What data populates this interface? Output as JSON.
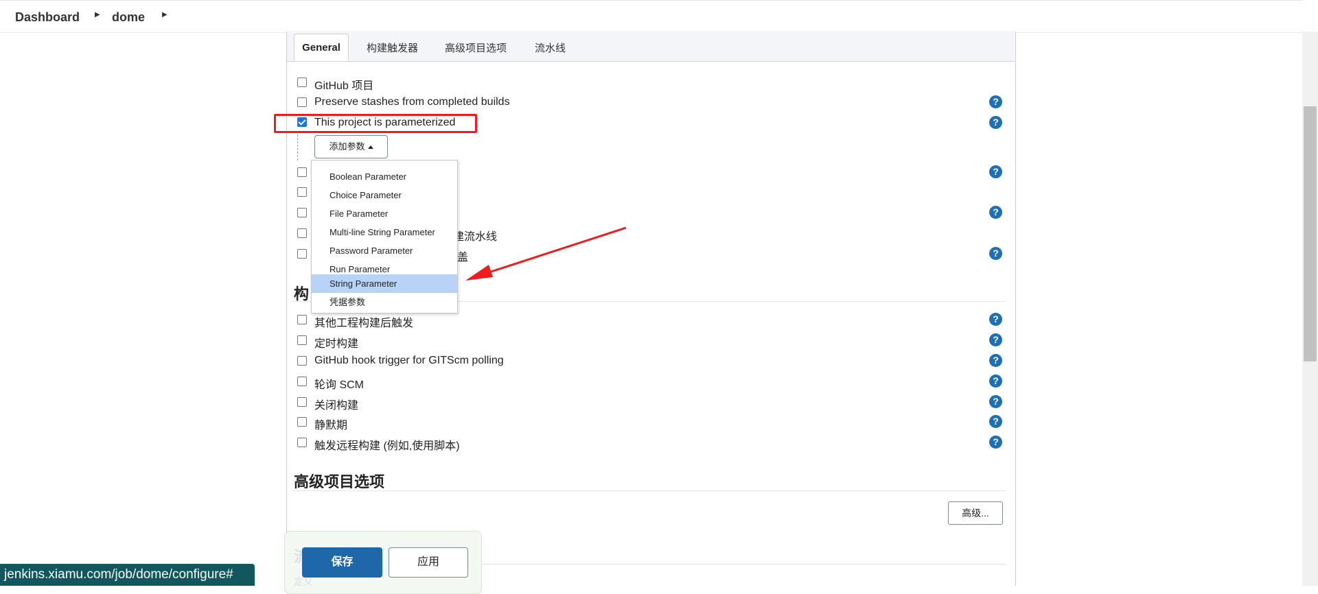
{
  "breadcrumb": [
    "Dashboard",
    "dome"
  ],
  "tabs": [
    "General",
    "构建触发器",
    "高级项目选项",
    "流水线"
  ],
  "general_options": [
    {
      "label": "GitHub 项目",
      "checked": false,
      "help": false
    },
    {
      "label": "Preserve stashes from completed builds",
      "checked": false,
      "help": true
    },
    {
      "label": "This project is parameterized",
      "checked": true,
      "help": true
    }
  ],
  "add_param_button": "添加参数",
  "hidden_row_fragments": [
    "建流水线",
    "盖"
  ],
  "param_menu": [
    "Boolean Parameter",
    "Choice Parameter",
    "File Parameter",
    "Multi-line String Parameter",
    "Password Parameter",
    "Run Parameter",
    "String Parameter",
    "凭据参数"
  ],
  "selected_param": "String Parameter",
  "build_triggers": {
    "title_fragment": "构",
    "options": [
      "其他工程构建后触发",
      "定时构建",
      "GitHub hook trigger for GITScm polling",
      "轮询 SCM",
      "关闭构建",
      "静默期",
      "触发远程构建 (例如,使用脚本)"
    ]
  },
  "advanced_section": {
    "title": "高级项目选项",
    "button": "高级..."
  },
  "pipeline_ghost": {
    "title": "流水线",
    "sub": "定义"
  },
  "footer": {
    "save": "保存",
    "apply": "应用"
  },
  "status_url": "jenkins.xiamu.com/job/dome/configure#",
  "colors": {
    "highlight": "#ee1c1c",
    "primary": "#1e67a8",
    "help": "#1e6fb5",
    "status_bg": "#11575d"
  }
}
